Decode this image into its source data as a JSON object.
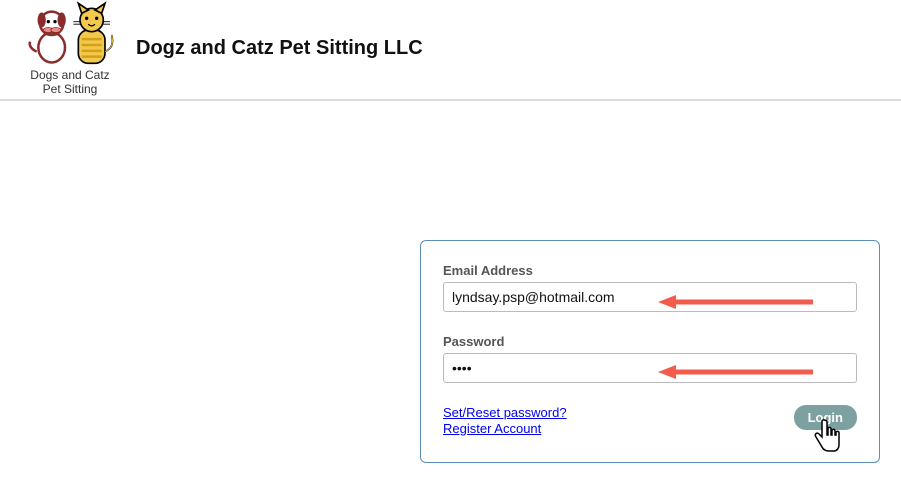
{
  "header": {
    "logo_line1": "Dogs and Catz",
    "logo_line2": "Pet Sitting",
    "title": "Dogz and Catz Pet Sitting LLC"
  },
  "login": {
    "email_label": "Email Address",
    "email_value": "lyndsay.psp@hotmail.com",
    "password_label": "Password",
    "password_value": "abcd",
    "reset_link": "Set/Reset password?",
    "register_link": "Register Account",
    "login_button": "Login"
  },
  "annotations": {
    "arrows": 2,
    "arrow_color": "#f25c4d",
    "cursor": "pointing-hand"
  }
}
